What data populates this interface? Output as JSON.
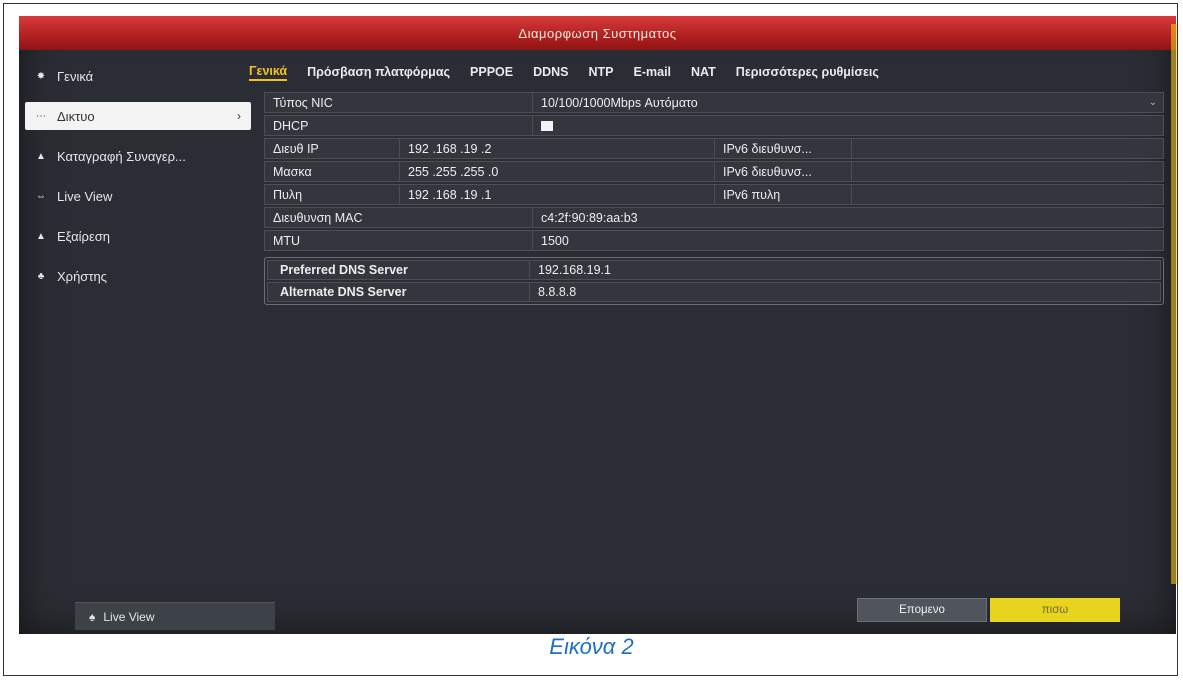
{
  "window": {
    "title": "Διαμορφωση Συστηματος"
  },
  "sidebar": {
    "items": [
      {
        "label": "Γενικά",
        "icon": "gear-icon",
        "glyph": "✸",
        "active": false
      },
      {
        "label": "Δικτυο",
        "icon": "network-icon",
        "glyph": "⋯",
        "active": true
      },
      {
        "label": "Καταγραφή Συναγερ...",
        "icon": "alarm-icon",
        "glyph": "▲",
        "active": false
      },
      {
        "label": "Live View",
        "icon": "live-view-icon",
        "glyph": "⇔",
        "active": false
      },
      {
        "label": "Εξαίρεση",
        "icon": "exception-icon",
        "glyph": "▲",
        "active": false
      },
      {
        "label": "Χρήστης",
        "icon": "user-icon",
        "glyph": "♣",
        "active": false
      }
    ],
    "bottom_button": {
      "label": "Live View",
      "icon": "home-icon",
      "glyph": "♠"
    }
  },
  "tabs": [
    {
      "label": "Γενικά",
      "active": true
    },
    {
      "label": "Πρόσβαση πλατφόρμας",
      "active": false
    },
    {
      "label": "PPPOE",
      "active": false
    },
    {
      "label": "DDNS",
      "active": false
    },
    {
      "label": "NTP",
      "active": false
    },
    {
      "label": "E-mail",
      "active": false
    },
    {
      "label": "NAT",
      "active": false
    },
    {
      "label": "Περισσότερες ρυθμίσεις",
      "active": false
    }
  ],
  "form": {
    "nic_type": {
      "label": "Τύπος NIC",
      "value": "10/100/1000Mbps Αυτόματο"
    },
    "dhcp": {
      "label": "DHCP",
      "checked": false
    },
    "ip": {
      "label": "Διευθ IP",
      "value": "192 .168 .19  .2",
      "ipv6_label": "IPv6 διευθυνσ...",
      "ipv6_value": ""
    },
    "mask": {
      "label": "Μασκα",
      "value": "255 .255 .255 .0",
      "ipv6_label": "IPv6 διευθυνσ...",
      "ipv6_value": ""
    },
    "gateway": {
      "label": "Πυλη",
      "value": "192 .168 .19  .1",
      "ipv6_label": "IPv6 πυλη",
      "ipv6_value": ""
    },
    "mac": {
      "label": "Διευθυνση MAC",
      "value": "c4:2f:90:89:aa:b3"
    },
    "mtu": {
      "label": "MTU",
      "value": "1500"
    },
    "dns_preferred": {
      "label": "Preferred DNS Server",
      "value": "192.168.19.1"
    },
    "dns_alternate": {
      "label": "Alternate DNS Server",
      "value": "8.8.8.8"
    }
  },
  "buttons": {
    "next": "Επομενο",
    "back": "πισω"
  },
  "caption": "Εικόνα 2",
  "colors": {
    "titlebar": "#b82020",
    "accent_tab": "#f5c21b",
    "back_button": "#e8d31f",
    "caption": "#1f6fc8"
  }
}
